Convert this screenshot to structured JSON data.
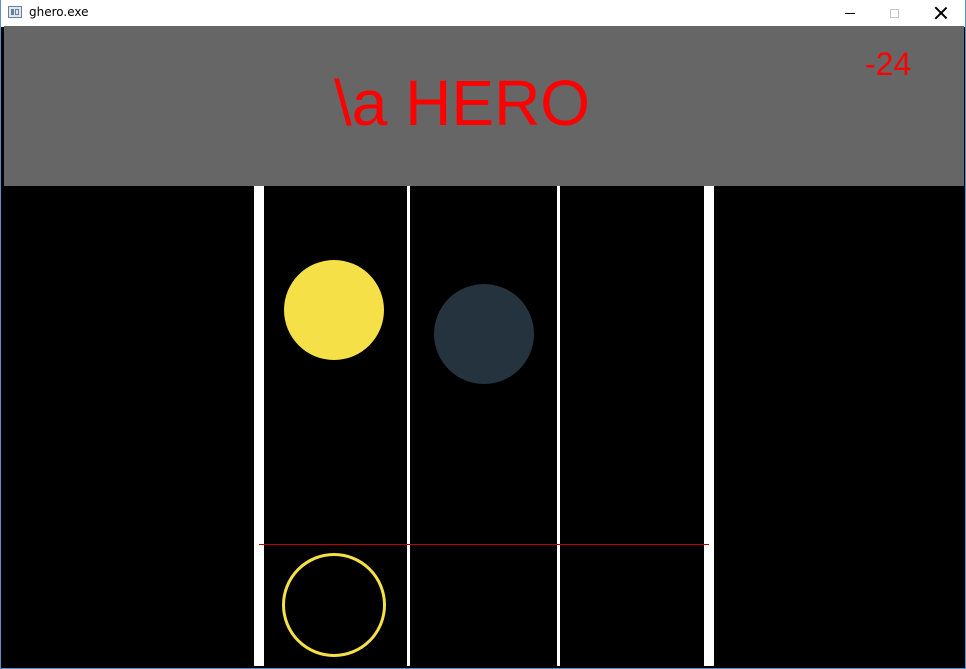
{
  "window": {
    "title": "ghero.exe",
    "controls": {
      "minimize": "minimize",
      "maximize": "maximize",
      "close": "close"
    }
  },
  "game": {
    "title": "\\a HERO",
    "score": "-24",
    "colors": {
      "header_bg": "#666666",
      "title_text": "#ff0000",
      "playfield_bg": "#000000",
      "lane_line": "#ffffff",
      "hit_line": "#c00000",
      "note_yellow": "#f5e147",
      "note_dark": "#25333f"
    },
    "lanes": 3,
    "notes": [
      {
        "lane": 1,
        "color": "yellow"
      },
      {
        "lane": 2,
        "color": "dark"
      }
    ],
    "targets": [
      {
        "lane": 1,
        "color": "yellow"
      }
    ]
  }
}
